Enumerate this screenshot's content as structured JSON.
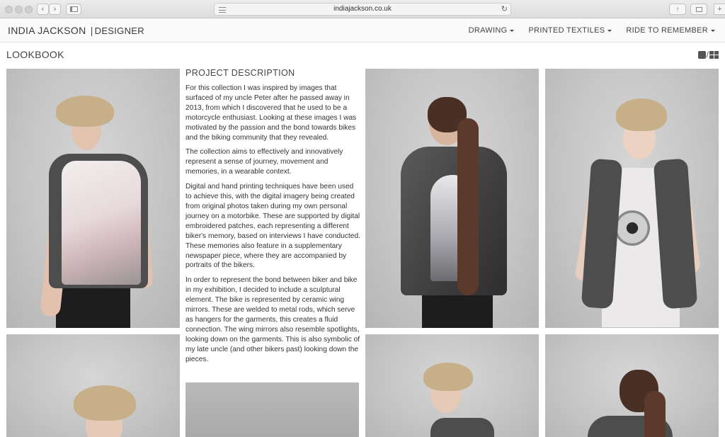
{
  "browser": {
    "url": "indiajackson.co.uk",
    "new_tab": "+"
  },
  "header": {
    "brand_name": "INDIA JACKSON",
    "brand_sep": "|",
    "brand_role": "DESIGNER",
    "nav": [
      {
        "label": "DRAWING"
      },
      {
        "label": "PRINTED TEXTILES"
      },
      {
        "label": "RIDE TO REMEMBER"
      }
    ]
  },
  "page": {
    "title": "LOOKBOOK",
    "view_sep": "/"
  },
  "description": {
    "title": "PROJECT DESCRIPTION",
    "paragraphs": [
      "For this collection I was inspired by images that surfaced of my uncle Peter after he passed away in 2013, from which I discovered that he used to be a motorcycle enthusiast. Looking at these images I was motivated by the passion and the bond towards bikes and the biking community that they revealed.",
      "The collection aims to effectively and innovatively represent a sense of journey, movement and memories, in a wearable context.",
      "Digital and hand printing techniques have been used to achieve this, with the digital imagery being created from original photos taken during my own personal journey on a motorbike. These are supported by digital embroidered patches, each representing a different biker's memory, based on interviews I have conducted. These memories also feature in a supplementary newspaper piece, where they are accompanied by portraits of the bikers.",
      "In order to represent the bond between biker and bike in my exhibition, I decided to include a sculptural element. The bike is represented by ceramic wing mirrors. These are welded to metal rods, which serve as hangers for the garments, this creates a fluid connection. The wing mirrors also resemble spotlights, looking down on the garments. This is also symbolic of my late uncle (and other bikers past) looking down the pieces."
    ]
  }
}
